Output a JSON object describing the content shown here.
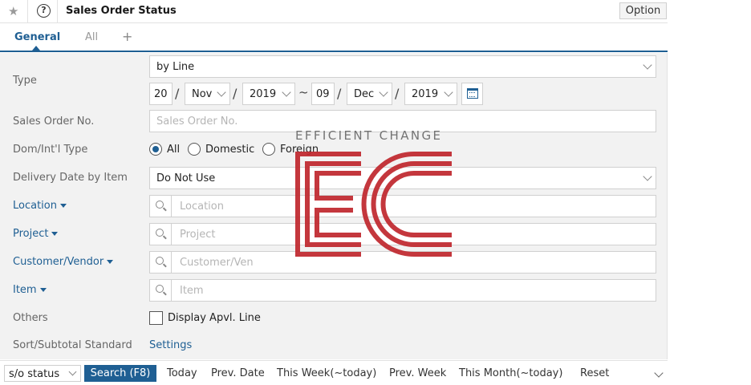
{
  "header": {
    "title": "Sales Order Status",
    "option_label": "Option",
    "help_glyph": "?"
  },
  "tabs": [
    {
      "label": "General",
      "active": true
    },
    {
      "label": "All",
      "active": false
    }
  ],
  "tab_add": "+",
  "form": {
    "type": {
      "label": "Type",
      "value": "by Line"
    },
    "date_range": {
      "from_day": "20",
      "from_month": "Nov",
      "from_year": "2019",
      "separator": "~",
      "to_day": "09",
      "to_month": "Dec",
      "to_year": "2019"
    },
    "sales_order_no": {
      "label": "Sales Order No.",
      "placeholder": "Sales Order No."
    },
    "dom_intl_type": {
      "label": "Dom/Int'l Type",
      "options": [
        "All",
        "Domestic",
        "Foreign"
      ],
      "selected": "All"
    },
    "delivery_date": {
      "label": "Delivery Date by Item",
      "value": "Do Not Use"
    },
    "location": {
      "label": "Location",
      "placeholder": "Location"
    },
    "project": {
      "label": "Project",
      "placeholder": "Project"
    },
    "customer_vendor": {
      "label": "Customer/Vendor",
      "placeholder": "Customer/Ven"
    },
    "item": {
      "label": "Item",
      "placeholder": "Item"
    },
    "others": {
      "label": "Others",
      "checkbox_label": "Display Apvl. Line",
      "checked": false
    },
    "sort": {
      "label": "Sort/Subtotal Standard",
      "link": "Settings"
    }
  },
  "footer": {
    "select_value": "s/o status",
    "search_label": "Search (F8)",
    "links": [
      "Today",
      "Prev. Date",
      "This Week(~today)",
      "Prev. Week",
      "This Month(~today)",
      "Reset"
    ]
  },
  "watermark": {
    "text": "EFFICIENT CHANGE",
    "color": "#c0272d"
  },
  "colors": {
    "accent": "#1f5f93",
    "form_bg": "#f2f2f2"
  }
}
